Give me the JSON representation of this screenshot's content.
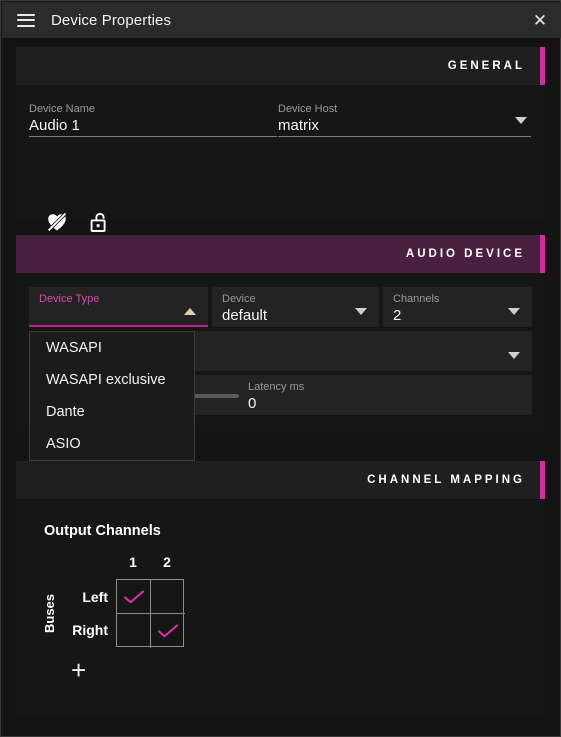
{
  "window": {
    "title": "Device Properties",
    "menu_icon": "hamburger-icon",
    "close_icon": "close-icon"
  },
  "colors": {
    "accent_pink": "#cf2fa0",
    "header_plum": "#4a2040",
    "panel_bg": "#161616",
    "field_bg": "#232323",
    "titlebar_bg": "#2b2b2b"
  },
  "sections": {
    "general": {
      "label": "GENERAL",
      "device_name": {
        "label": "Device Name",
        "value": "Audio 1"
      },
      "device_host": {
        "label": "Device Host",
        "value": "matrix"
      },
      "toggles": [
        {
          "name": "favorite-off-icon",
          "label": "Favorite"
        },
        {
          "name": "unlock-icon",
          "label": "Unlocked"
        }
      ]
    },
    "audio_device": {
      "label": "AUDIO DEVICE",
      "device_type": {
        "label": "Device Type",
        "value": "",
        "expanded": true,
        "options": [
          "WASAPI",
          "WASAPI exclusive",
          "Dante",
          "ASIO"
        ]
      },
      "device": {
        "label": "Device",
        "value": "default"
      },
      "channels": {
        "label": "Channels",
        "value": "2"
      },
      "sample_rate": {
        "label": "",
        "value": ""
      },
      "latency": {
        "label": "Latency ms",
        "value": "0",
        "slider_percent": 12
      }
    },
    "channel_mapping": {
      "label": "CHANNEL MAPPING",
      "output_channels_title": "Output Channels",
      "buses_label": "Buses",
      "columns": [
        "1",
        "2"
      ],
      "rows": [
        "Left",
        "Right"
      ],
      "matrix": [
        [
          true,
          false
        ],
        [
          false,
          true
        ]
      ],
      "add_label": "+"
    }
  }
}
